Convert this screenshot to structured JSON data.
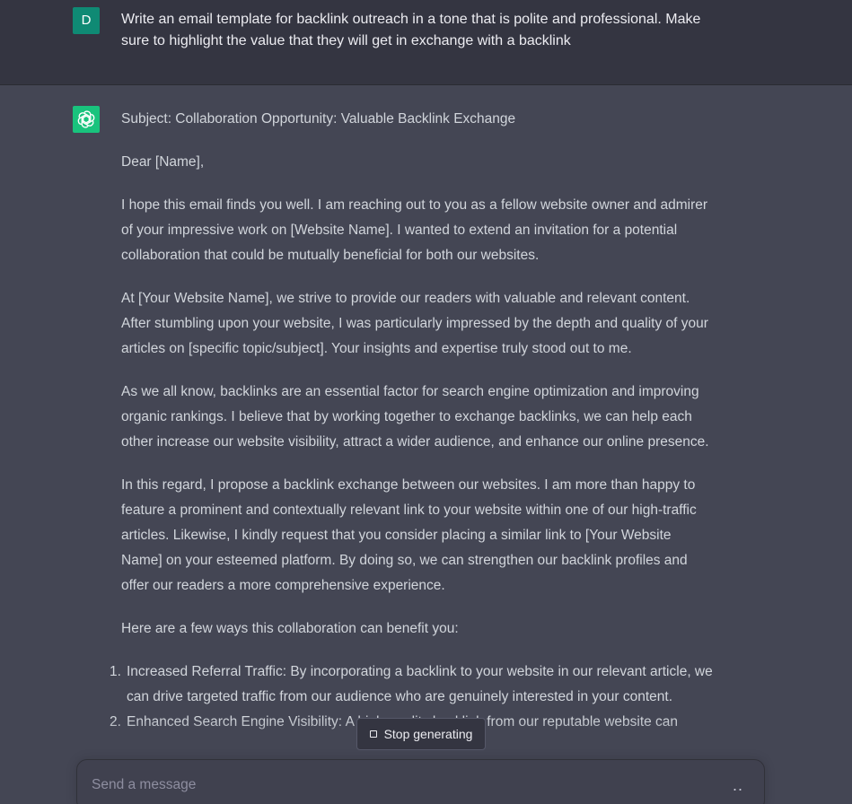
{
  "user_message": {
    "avatar_letter": "D",
    "text": "Write an email template for backlink outreach in a tone that is polite and professional. Make sure to highlight the value that they will get in exchange with a backlink"
  },
  "assistant_message": {
    "avatar_icon": "openai-logo-icon",
    "paragraphs": [
      "Subject: Collaboration Opportunity: Valuable Backlink Exchange",
      "Dear [Name],",
      "I hope this email finds you well. I am reaching out to you as a fellow website owner and admirer of your impressive work on [Website Name]. I wanted to extend an invitation for a potential collaboration that could be mutually beneficial for both our websites.",
      "At [Your Website Name], we strive to provide our readers with valuable and relevant content. After stumbling upon your website, I was particularly impressed by the depth and quality of your articles on [specific topic/subject]. Your insights and expertise truly stood out to me.",
      "As we all know, backlinks are an essential factor for search engine optimization and improving organic rankings. I believe that by working together to exchange backlinks, we can help each other increase our website visibility, attract a wider audience, and enhance our online presence.",
      "In this regard, I propose a backlink exchange between our websites. I am more than happy to feature a prominent and contextually relevant link to your website within one of our high-traffic articles. Likewise, I kindly request that you consider placing a similar link to [Your Website Name] on your esteemed platform. By doing so, we can strengthen our backlink profiles and offer our readers a more comprehensive experience.",
      "Here are a few ways this collaboration can benefit you:"
    ],
    "list_items": [
      {
        "number": "1.",
        "text": "Increased Referral Traffic: By incorporating a backlink to your website in our relevant article, we can drive targeted traffic from our audience who are genuinely interested in your content."
      },
      {
        "number": "2.",
        "text": "Enhanced Search Engine Visibility: A high-quality backlink from our reputable website can"
      }
    ]
  },
  "stop_button": {
    "label": "Stop generating"
  },
  "composer": {
    "placeholder": "Send a message",
    "typing_indicator": ".."
  },
  "colors": {
    "user_background": "#343541",
    "assistant_background": "#444654",
    "user_avatar": "#0f8a74",
    "assistant_avatar": "#19c37d",
    "text": "#d1d5db"
  }
}
